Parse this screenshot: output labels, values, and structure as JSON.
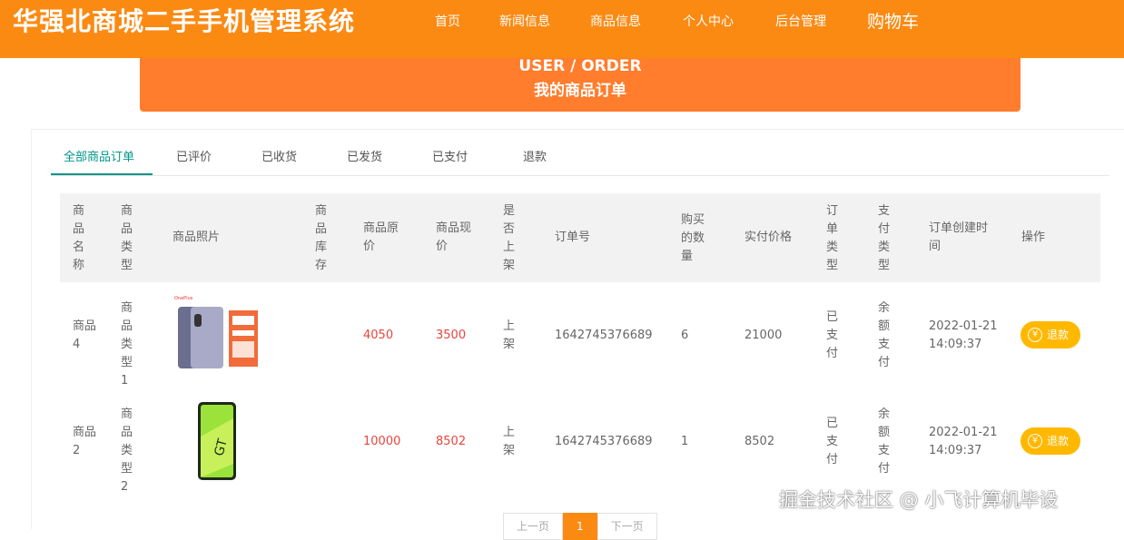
{
  "header": {
    "title": "华强北商城二手手机管理系统",
    "nav": [
      "首页",
      "新闻信息",
      "商品信息",
      "个人中心",
      "后台管理",
      "购物车"
    ]
  },
  "banner": {
    "en": "USER / ORDER",
    "zh": "我的商品订单"
  },
  "tabs": [
    "全部商品订单",
    "已评价",
    "已收货",
    "已发货",
    "已支付",
    "退款"
  ],
  "table": {
    "headers": [
      "商品名称",
      "商品类型",
      "商品照片",
      "商品库存",
      "商品原价",
      "商品现价",
      "是否上架",
      "订单号",
      "购买的数量",
      "实付价格",
      "订单类型",
      "支付类型",
      "订单创建时间",
      "操作"
    ],
    "rows": [
      {
        "name": "商品4",
        "type": "商品类型1",
        "photo": "oneplus-phone-image",
        "stock": "",
        "original_price": "4050",
        "current_price": "3500",
        "listed": "上架",
        "order_no": "1642745376689",
        "qty": "6",
        "paid": "21000",
        "order_type": "已支付",
        "pay_type": "余额支付",
        "created": "2022-01-21 14:09:37",
        "action": "退款"
      },
      {
        "name": "商品2",
        "type": "商品类型2",
        "photo": "realme-gt-phone-image",
        "stock": "",
        "original_price": "10000",
        "current_price": "8502",
        "listed": "上架",
        "order_no": "1642745376689",
        "qty": "1",
        "paid": "8502",
        "order_type": "已支付",
        "pay_type": "余额支付",
        "created": "2022-01-21 14:09:37",
        "action": "退款"
      }
    ]
  },
  "pagination": {
    "prev": "上一页",
    "current": "1",
    "next": "下一页"
  },
  "watermark": "掘金技术社区 @ 小飞计算机毕设",
  "colors": {
    "brand": "#fb8a13",
    "banner": "#ff7d2d",
    "tab_active": "#009688",
    "price": "#e8453c",
    "button": "#ffb800"
  }
}
